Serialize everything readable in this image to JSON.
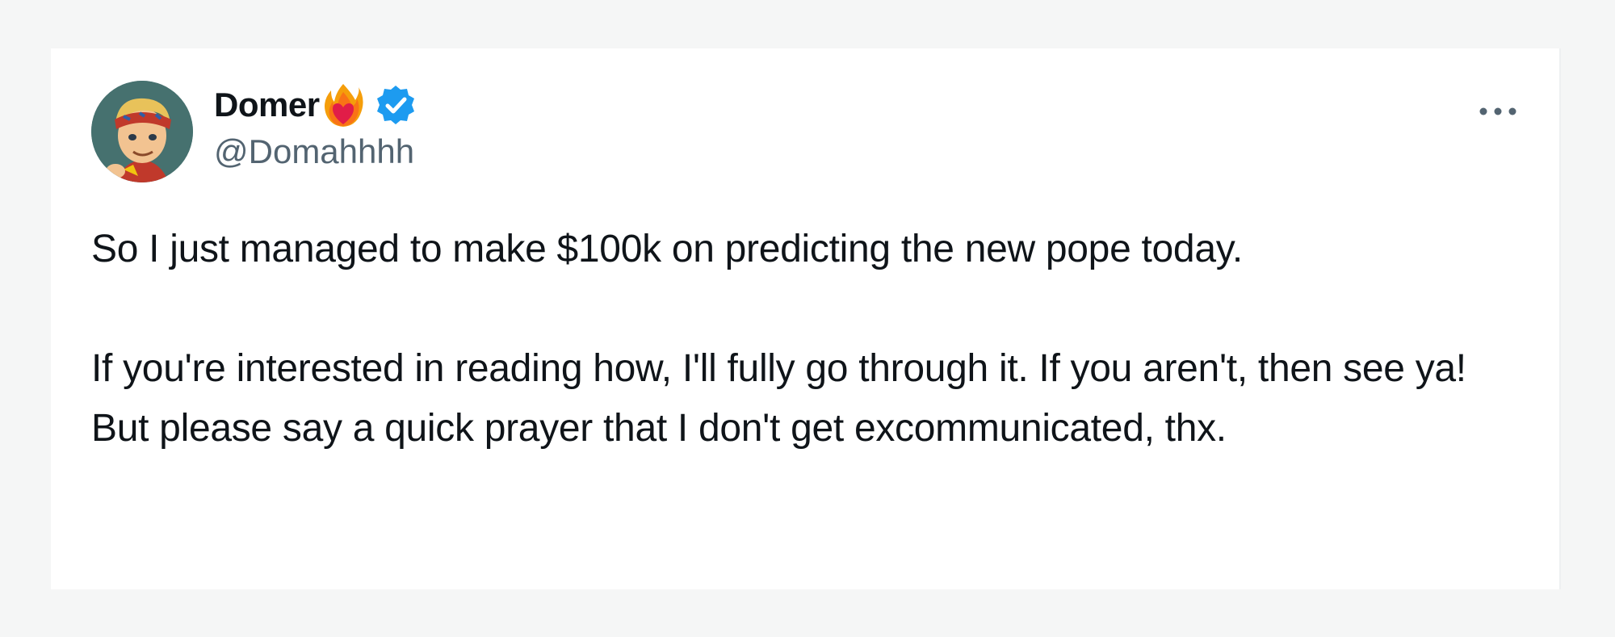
{
  "tweet": {
    "author": {
      "display_name": "Domer",
      "handle": "@Domahhhh",
      "name_emoji": "heart-on-fire-icon",
      "verified_badge": "verified-badge-icon",
      "avatar": "avatar-cartoon-headband"
    },
    "more_menu_icon": "more-horizontal-icon",
    "paragraphs": [
      "So I just managed to make $100k on predicting the new pope today.",
      "If you're interested in reading how, I'll fully go through it. If you aren't, then see ya! But please say a quick prayer that I don't get excommunicated, thx."
    ]
  },
  "colors": {
    "page_background": "#f5f6f6",
    "card_background": "#ffffff",
    "text_primary": "#0f1419",
    "text_secondary": "#536471",
    "verified_blue": "#1d9bf0"
  }
}
